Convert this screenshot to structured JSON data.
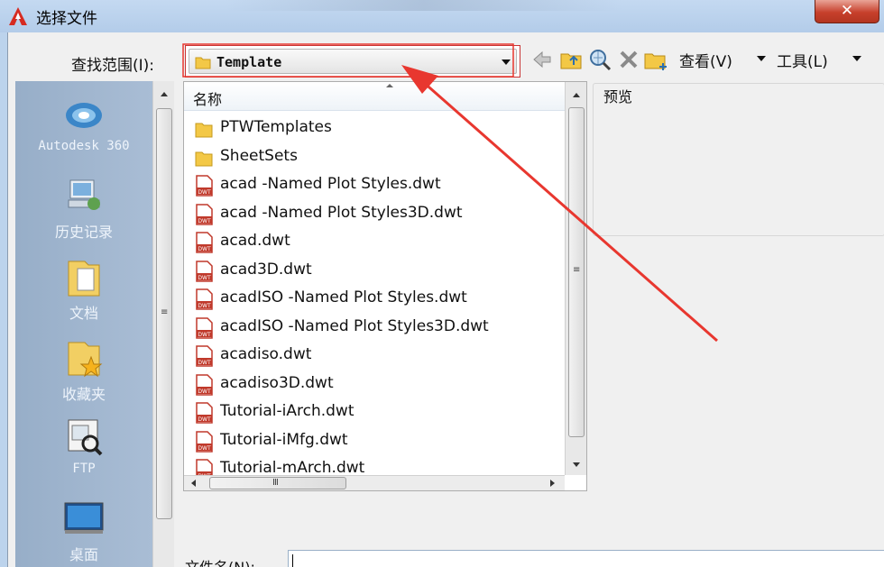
{
  "window": {
    "title": "选择文件",
    "close_label": "✕"
  },
  "toolbar": {
    "lookin_label": "查找范围(I):",
    "lookin_value": "Template",
    "buttons": [
      "back-icon",
      "up-folder-icon",
      "search-web-icon",
      "delete-icon",
      "new-folder-icon"
    ],
    "views_label": "查看(V)",
    "tools_label": "工具(L)"
  },
  "places": [
    {
      "label": "Autodesk 360",
      "icon": "cloud-icon"
    },
    {
      "label": "历史记录",
      "icon": "history-icon"
    },
    {
      "label": "文档",
      "icon": "documents-icon"
    },
    {
      "label": "收藏夹",
      "icon": "favorites-icon"
    },
    {
      "label": "FTP",
      "icon": "ftp-icon"
    },
    {
      "label": "桌面",
      "icon": "desktop-icon"
    }
  ],
  "filelist": {
    "column_name": "名称",
    "items": [
      {
        "name": "PTWTemplates",
        "type": "folder"
      },
      {
        "name": "SheetSets",
        "type": "folder"
      },
      {
        "name": "acad -Named Plot Styles.dwt",
        "type": "dwt"
      },
      {
        "name": "acad -Named Plot Styles3D.dwt",
        "type": "dwt"
      },
      {
        "name": "acad.dwt",
        "type": "dwt"
      },
      {
        "name": "acad3D.dwt",
        "type": "dwt"
      },
      {
        "name": "acadISO -Named Plot Styles.dwt",
        "type": "dwt"
      },
      {
        "name": "acadISO -Named Plot Styles3D.dwt",
        "type": "dwt"
      },
      {
        "name": "acadiso.dwt",
        "type": "dwt"
      },
      {
        "name": "acadiso3D.dwt",
        "type": "dwt"
      },
      {
        "name": "Tutorial-iArch.dwt",
        "type": "dwt"
      },
      {
        "name": "Tutorial-iMfg.dwt",
        "type": "dwt"
      },
      {
        "name": "Tutorial-mArch.dwt",
        "type": "dwt"
      }
    ]
  },
  "preview": {
    "label": "预览"
  },
  "filename": {
    "label": "文件名(N):",
    "value": ""
  },
  "colors": {
    "annotation_red": "#e8372f",
    "folder_yellow": "#f3c846",
    "dwt_red": "#c0392b",
    "places_bg": "#a9bdd4"
  }
}
